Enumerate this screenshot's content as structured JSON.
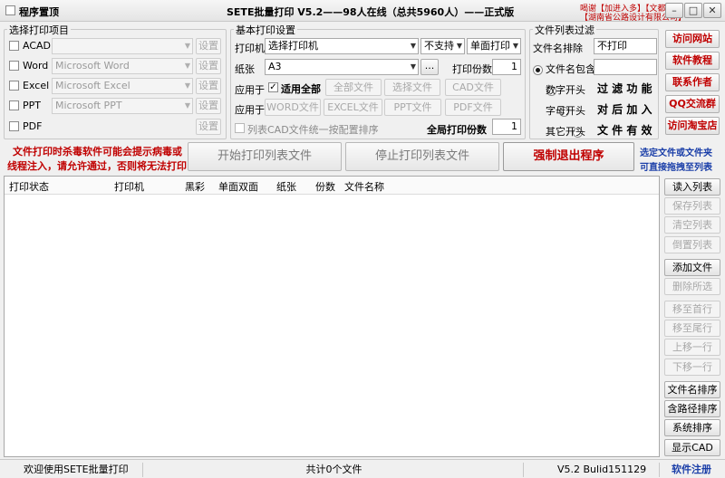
{
  "window": {
    "title": "SETE批量打印 V5.2——98人在线（总共5960人）——正式版",
    "menu_checkbox_label": "程序置顶",
    "topright_links": [
      "喝谢【加进入多】【文都】",
      "【湖南省公路设计有限公司】"
    ],
    "controls": [
      "–",
      "□",
      "✕"
    ]
  },
  "select_items": {
    "title": "选择打印项目",
    "rows": [
      {
        "label": "ACAD",
        "combo": "",
        "button": "设置"
      },
      {
        "label": "Word",
        "combo": "Microsoft Word",
        "button": "设置"
      },
      {
        "label": "Excel",
        "combo": "Microsoft Excel",
        "button": "设置"
      },
      {
        "label": "PPT",
        "combo": "Microsoft PPT",
        "button": "设置"
      },
      {
        "label": "PDF",
        "combo": "",
        "button": "设置"
      }
    ]
  },
  "basic": {
    "title": "基本打印设置",
    "printer_label": "打印机",
    "printer_value": "选择打印机",
    "support_value": "不支持",
    "duplex_value": "单面打印",
    "paper_label": "纸张",
    "paper_value": "A3",
    "more_button": "...",
    "copies_label": "打印份数",
    "copies_value": "1",
    "apply_label": "应用于",
    "apply_all_label": "适用全部",
    "apply_row1": [
      "全部文件",
      "选择文件",
      "CAD文件"
    ],
    "apply_row2": [
      "WORD文件",
      "EXCEL文件",
      "PPT文件",
      "PDF文件"
    ],
    "cad_unified_label": "列表CAD文件统一按配置排序",
    "global_copies_label": "全局打印份数",
    "global_copies_value": "1"
  },
  "filter": {
    "title": "文件列表过滤",
    "exclude_label": "文件名排除",
    "exclude_value": "不打印",
    "options": [
      "文件名包含",
      "数字开头",
      "字母开头",
      "其它开头"
    ],
    "side_text": [
      "过 滤 功 能",
      "对 后 加 入",
      "文 件 有 效"
    ]
  },
  "links": [
    "访问网站",
    "软件教程",
    "联系作者",
    "QQ交流群",
    "访问淘宝店"
  ],
  "warning": [
    "文件打印时杀毒软件可能会提示病毒或",
    "线程注入，请允许通过，否则将无法打印"
  ],
  "actions": {
    "start": "开始打印列表文件",
    "stop": "停止打印列表文件",
    "force_exit": "强制退出程序"
  },
  "drag_hint": [
    "选定文件或文件夹",
    "可直接拖拽至列表"
  ],
  "table": {
    "headers": [
      "打印状态",
      "打印机",
      "黑彩",
      "单面双面",
      "纸张",
      "份数",
      "文件名称"
    ]
  },
  "right_buttons": [
    "读入列表",
    "保存列表",
    "清空列表",
    "倒置列表",
    "添加文件",
    "删除所选",
    "移至首行",
    "移至尾行",
    "上移一行",
    "下移一行",
    "文件名排序",
    "含路径排序",
    "系统排序",
    "显示CAD"
  ],
  "status": {
    "welcome": "欢迎使用SETE批量打印",
    "count": "共计0个文件",
    "version": "V5.2 Bulid151129",
    "register": "软件注册"
  },
  "colors": {
    "red": "#c00000",
    "blue": "#1a3ea8"
  }
}
